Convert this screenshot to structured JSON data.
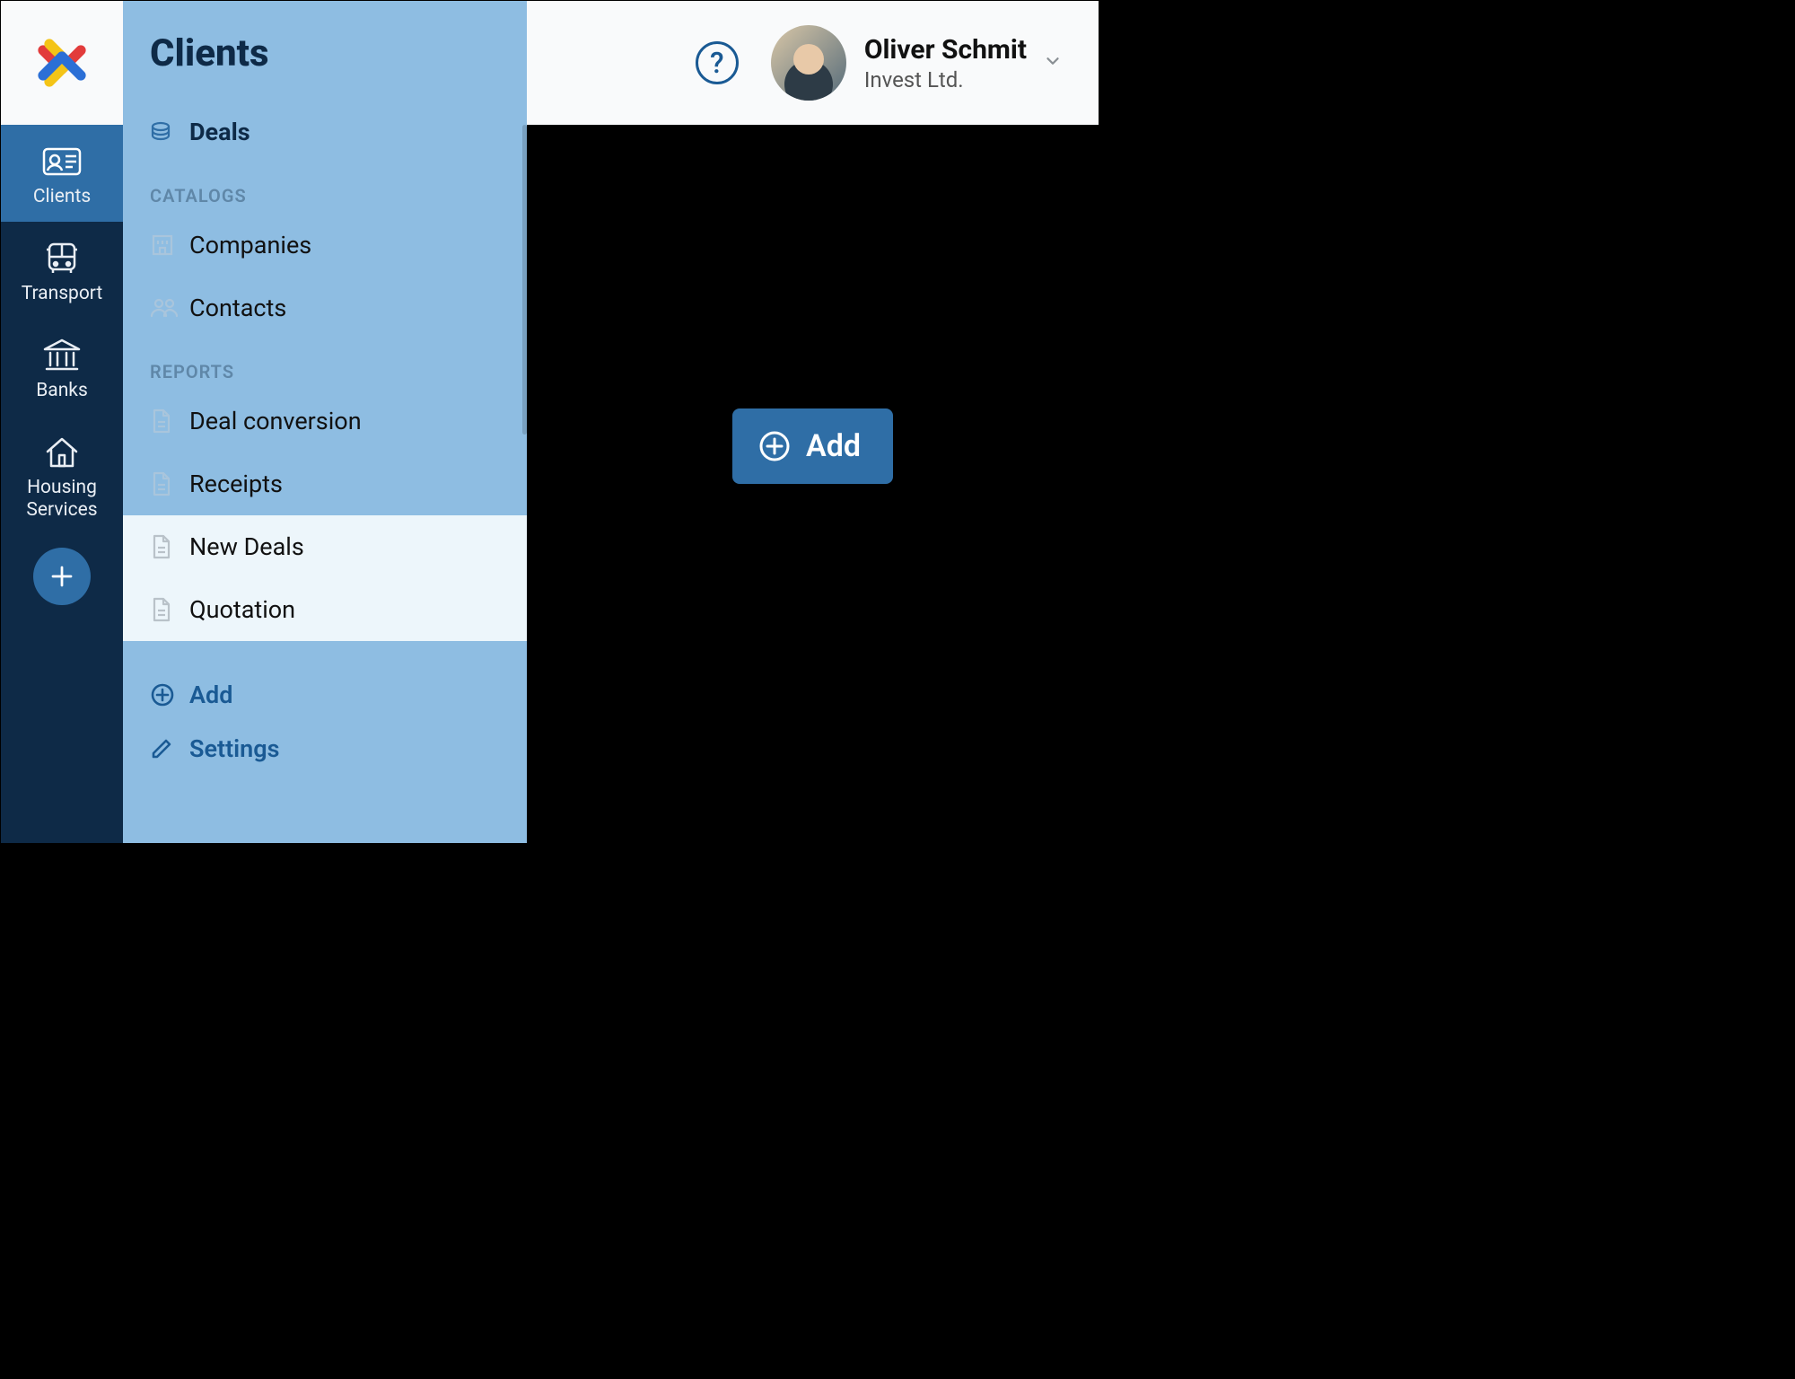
{
  "header": {
    "user_name": "Oliver Schmit",
    "user_org": "Invest Ltd.",
    "help_glyph": "?"
  },
  "rail": {
    "items": [
      {
        "key": "clients",
        "label": "Clients",
        "active": true
      },
      {
        "key": "transport",
        "label": "Transport",
        "active": false
      },
      {
        "key": "banks",
        "label": "Banks",
        "active": false
      },
      {
        "key": "housing",
        "label": "Housing Services",
        "active": false
      }
    ]
  },
  "panel": {
    "title": "Clients",
    "deals_label": "Deals",
    "section_catalogs": "CATALOGS",
    "companies_label": "Companies",
    "contacts_label": "Contacts",
    "section_reports": "REPORTS",
    "dealconv_label": "Deal conversion",
    "receipts_label": "Receipts",
    "newdeals_label": "New Deals",
    "quotation_label": "Quotation",
    "add_label": "Add",
    "settings_label": "Settings"
  },
  "main": {
    "add_button_label": "Add"
  }
}
